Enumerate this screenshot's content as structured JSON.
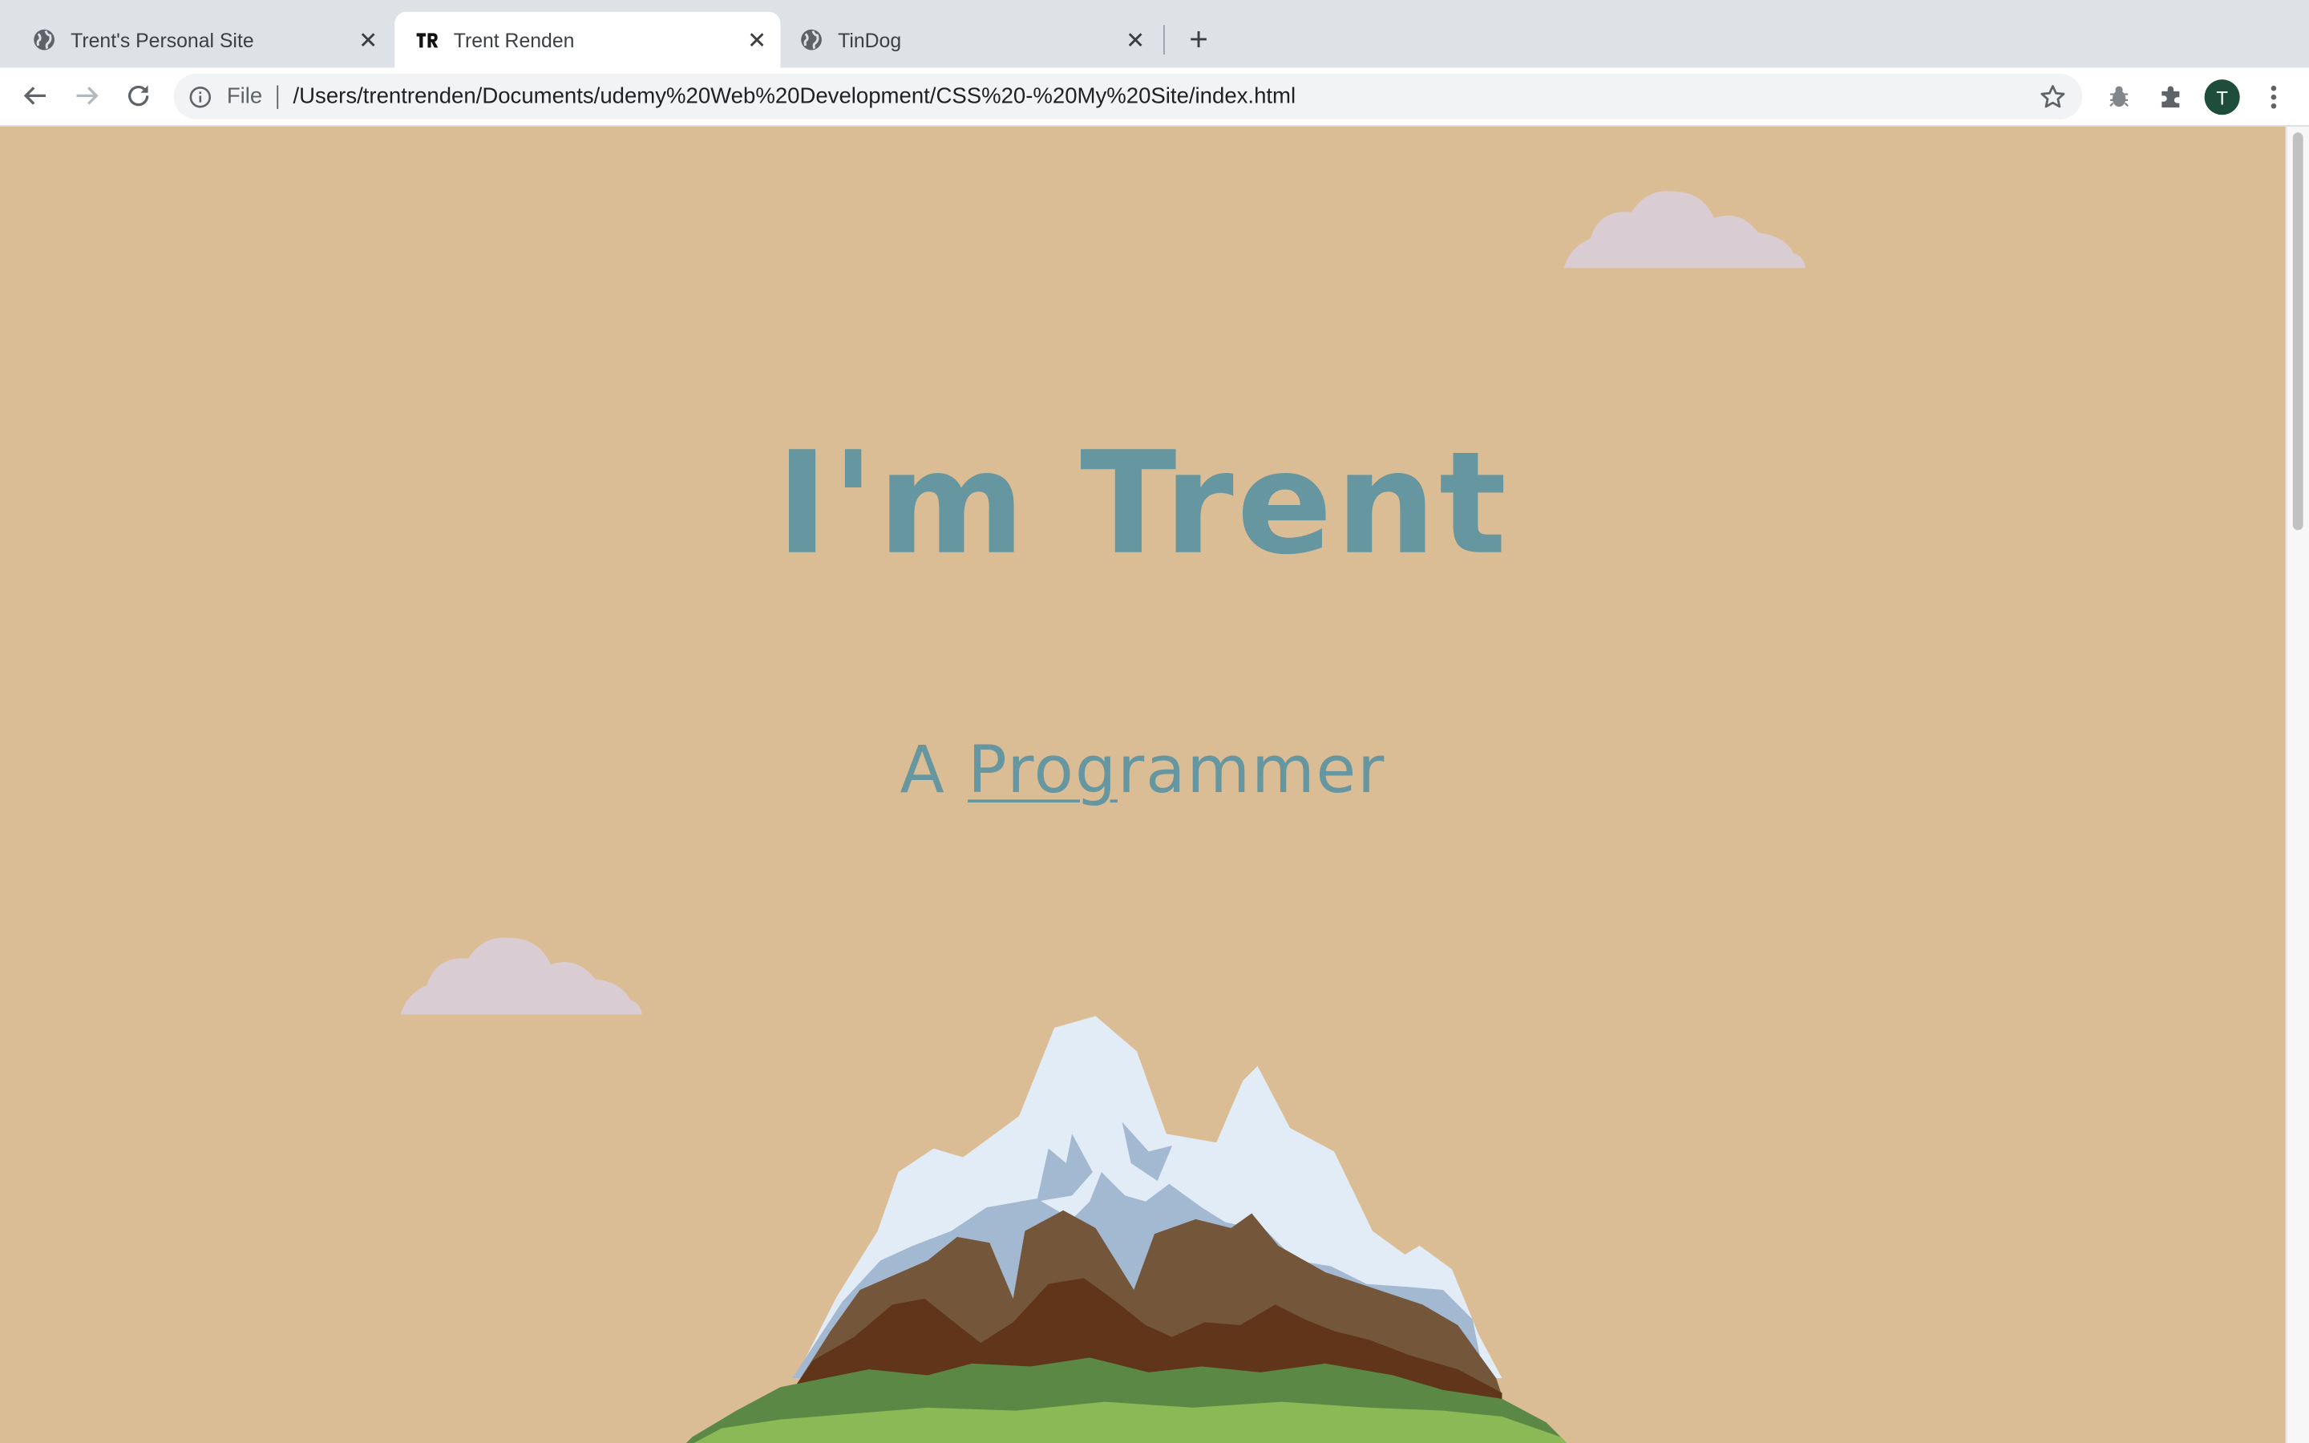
{
  "browser": {
    "tabs": [
      {
        "title": "Trent's Personal Site",
        "favicon": "globe-icon",
        "active": false
      },
      {
        "title": "Trent Renden",
        "favicon": "TR",
        "active": true
      },
      {
        "title": "TinDog",
        "favicon": "globe-icon",
        "active": false
      }
    ],
    "new_tab_label": "+",
    "omnibox": {
      "scheme_label": "File",
      "url": "/Users/trentrenden/Documents/udemy%20Web%20Development/CSS%20-%20My%20Site/index.html"
    },
    "profile_initial": "T",
    "icons": [
      "back-icon",
      "forward-icon",
      "reload-icon",
      "info-icon",
      "star-icon",
      "bug-extension-icon",
      "puzzle-extension-icon",
      "menu-icon"
    ]
  },
  "page": {
    "heading": "I'm Trent",
    "subheading": {
      "prefix": "A ",
      "underlined": "Prog",
      "suffix": "rammer"
    },
    "colors": {
      "background": "#dbbd95",
      "heading": "#66969f",
      "cloud": "#d9ccd3",
      "snow": "#e1ecf6",
      "snow_shadow": "#a3b8d1",
      "rock_light": "#74573a",
      "rock_dark": "#603519",
      "grass_dark": "#5b8845",
      "grass_light": "#8bb955"
    }
  }
}
